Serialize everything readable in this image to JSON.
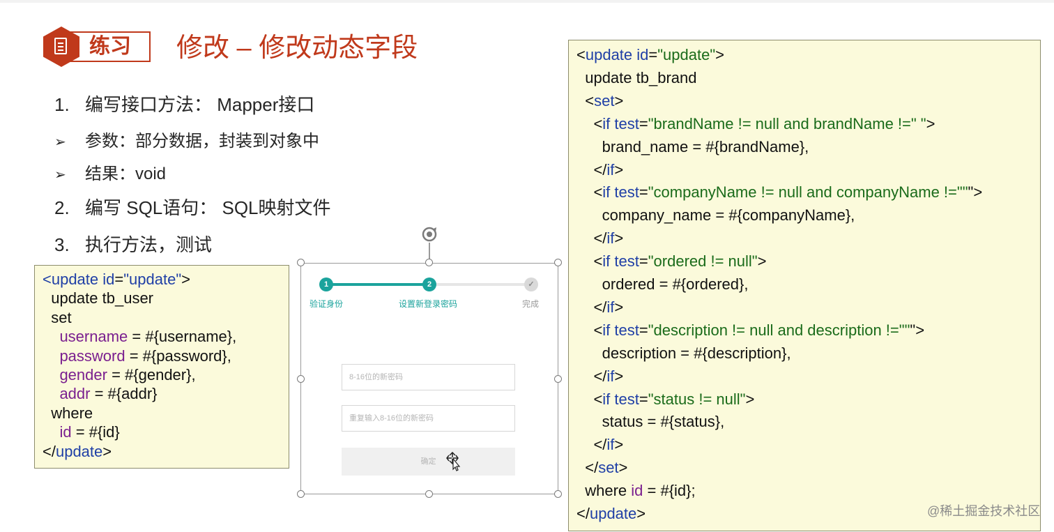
{
  "slide": {
    "badge_label": "练习",
    "title": "修改 – 修改动态字段",
    "list": [
      {
        "num": "1.",
        "text": "编写接口方法： Mapper接口"
      },
      {
        "bullet": "➢",
        "text": "参数：部分数据，封装到对象中"
      },
      {
        "bullet": "➢",
        "text": "结果：void"
      },
      {
        "num": "2.",
        "text": "编写 SQL语句： SQL映射文件"
      },
      {
        "num": "3.",
        "text": "执行方法，测试"
      }
    ]
  },
  "code_left": {
    "lines": [
      [
        [
          "kw",
          "<update "
        ],
        [
          "kw",
          "id"
        ],
        [
          "blk",
          "="
        ],
        [
          "str",
          ""
        ],
        [
          "kw",
          "\"update\""
        ],
        [
          "blk",
          ">"
        ]
      ],
      [
        [
          "blk",
          "  update tb_user"
        ]
      ],
      [
        [
          "blk",
          "  set"
        ]
      ],
      [
        [
          "pur",
          "    username"
        ],
        [
          "blk",
          " = #{username},"
        ]
      ],
      [
        [
          "pur",
          "    password"
        ],
        [
          "blk",
          " = #{password},"
        ]
      ],
      [
        [
          "pur",
          "    gender"
        ],
        [
          "blk",
          " = #{gender},"
        ]
      ],
      [
        [
          "pur",
          "    addr"
        ],
        [
          "blk",
          " = #{addr}"
        ]
      ],
      [
        [
          "blk",
          "  where"
        ]
      ],
      [
        [
          "pur",
          "    id"
        ],
        [
          "blk",
          " = #{id}"
        ]
      ],
      [
        [
          "blk",
          "</"
        ],
        [
          "kw",
          "update"
        ],
        [
          "blk",
          ">"
        ]
      ]
    ]
  },
  "code_right": {
    "lines": [
      [
        [
          "blk",
          "<"
        ],
        [
          "kw",
          "update id"
        ],
        [
          "blk",
          "="
        ],
        [
          "str",
          "\"update\""
        ],
        [
          "blk",
          ">"
        ]
      ],
      [
        [
          "blk",
          "  update tb_brand"
        ]
      ],
      [
        [
          "blk",
          "  <"
        ],
        [
          "kw",
          "set"
        ],
        [
          "blk",
          ">"
        ]
      ],
      [
        [
          "blk",
          "    <"
        ],
        [
          "kw",
          "if test"
        ],
        [
          "blk",
          "="
        ],
        [
          "str",
          "\"brandName != null and brandName !=\" \""
        ],
        [
          "blk",
          ">"
        ]
      ],
      [
        [
          "blk",
          "      brand_name = #{brandName},"
        ]
      ],
      [
        [
          "blk",
          "    </"
        ],
        [
          "kw",
          "if"
        ],
        [
          "blk",
          ">"
        ]
      ],
      [
        [
          "blk",
          "    <"
        ],
        [
          "kw",
          "if test"
        ],
        [
          "blk",
          "="
        ],
        [
          "str",
          "\"companyName != null and companyName !=\"\""
        ],
        [
          "blk",
          "\">"
        ]
      ],
      [
        [
          "blk",
          "      company_name = #{companyName},"
        ]
      ],
      [
        [
          "blk",
          "    </"
        ],
        [
          "kw",
          "if"
        ],
        [
          "blk",
          ">"
        ]
      ],
      [
        [
          "blk",
          "    <"
        ],
        [
          "kw",
          "if test"
        ],
        [
          "blk",
          "="
        ],
        [
          "str",
          "\"ordered != null\""
        ],
        [
          "blk",
          ">"
        ]
      ],
      [
        [
          "blk",
          "      ordered = #{ordered},"
        ]
      ],
      [
        [
          "blk",
          "    </"
        ],
        [
          "kw",
          "if"
        ],
        [
          "blk",
          ">"
        ]
      ],
      [
        [
          "blk",
          "    <"
        ],
        [
          "kw",
          "if test"
        ],
        [
          "blk",
          "="
        ],
        [
          "str",
          "\"description != null and description !=\"\""
        ],
        [
          "blk",
          "\">"
        ]
      ],
      [
        [
          "blk",
          "      description = #{description},"
        ]
      ],
      [
        [
          "blk",
          "    </"
        ],
        [
          "kw",
          "if"
        ],
        [
          "blk",
          ">"
        ]
      ],
      [
        [
          "blk",
          "    <"
        ],
        [
          "kw",
          "if test"
        ],
        [
          "blk",
          "="
        ],
        [
          "str",
          "\"status != null\""
        ],
        [
          "blk",
          ">"
        ]
      ],
      [
        [
          "blk",
          "      status = #{status},"
        ]
      ],
      [
        [
          "blk",
          "    </"
        ],
        [
          "kw",
          "if"
        ],
        [
          "blk",
          ">"
        ]
      ],
      [
        [
          "blk",
          "  </"
        ],
        [
          "kw",
          "set"
        ],
        [
          "blk",
          ">"
        ]
      ],
      [
        [
          "blk",
          "  where "
        ],
        [
          "pur",
          "id"
        ],
        [
          "blk",
          " = #{id};"
        ]
      ],
      [
        [
          "blk",
          "</"
        ],
        [
          "kw",
          "update"
        ],
        [
          "blk",
          ">"
        ]
      ]
    ]
  },
  "mockup": {
    "steps": [
      {
        "num": "1",
        "label": "验证身份",
        "state": "done"
      },
      {
        "num": "2",
        "label": "设置新登录密码",
        "state": "active"
      },
      {
        "num": "✓",
        "label": "完成",
        "state": "pending"
      }
    ],
    "password_placeholder": "8-16位的新密码",
    "confirm_placeholder": "重复输入8-16位的新密码",
    "submit_label": "确定",
    "accent_color": "#1ba39c"
  },
  "watermark": "@稀土掘金技术社区"
}
